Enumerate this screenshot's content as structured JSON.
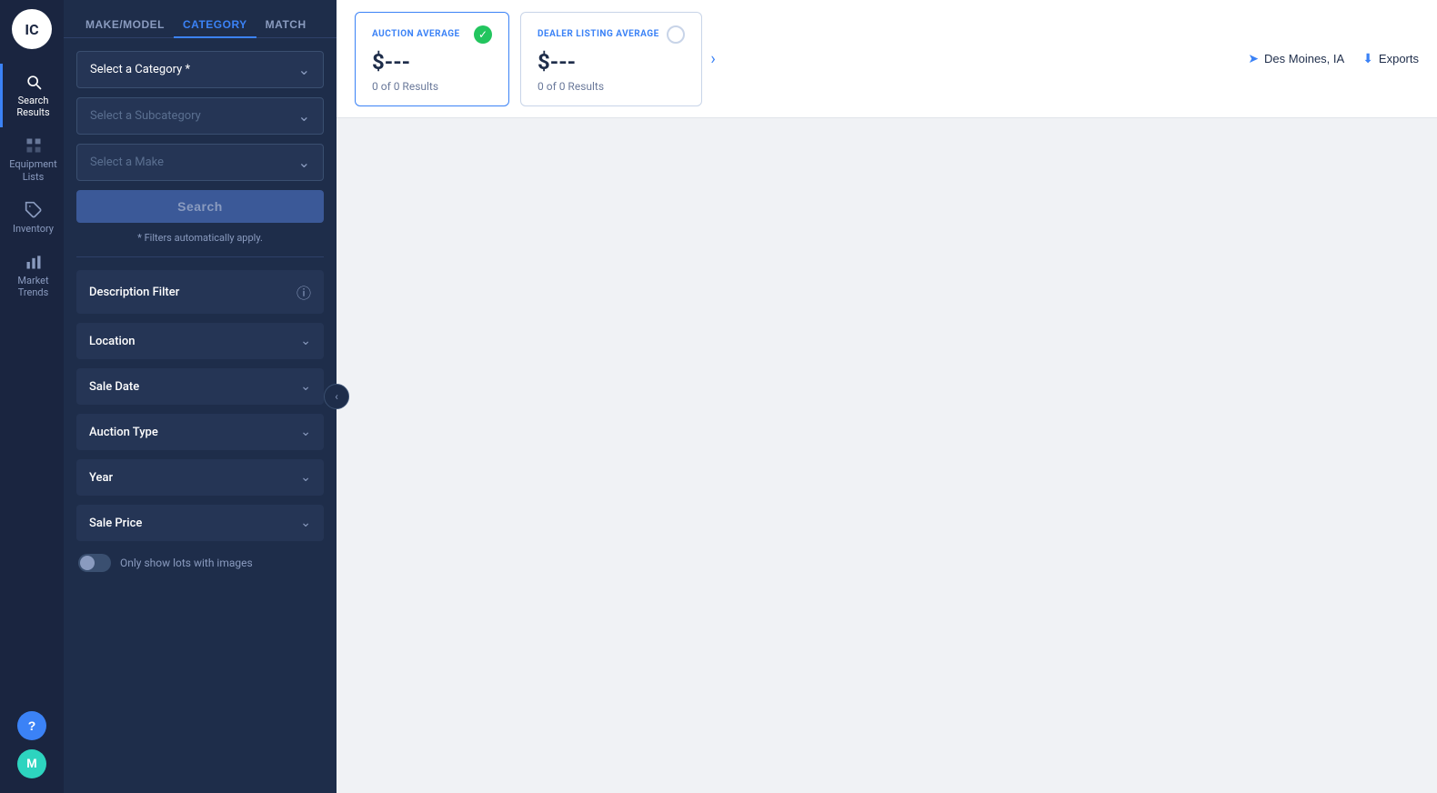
{
  "logo": {
    "text": "IC"
  },
  "nav": {
    "items": [
      {
        "id": "search-results",
        "label": "Search\nResults",
        "icon": "search",
        "active": true
      },
      {
        "id": "equipment-lists",
        "label": "Equipment\nLists",
        "icon": "list",
        "active": false
      },
      {
        "id": "inventory",
        "label": "Inventory",
        "icon": "tag",
        "active": false
      },
      {
        "id": "market-trends",
        "label": "Market\nTrends",
        "icon": "bar-chart",
        "active": false
      }
    ]
  },
  "tabs": [
    {
      "id": "make-model",
      "label": "MAKE/MODEL",
      "active": false
    },
    {
      "id": "category",
      "label": "CATEGORY",
      "active": true
    },
    {
      "id": "match",
      "label": "MATCH",
      "active": false
    }
  ],
  "selects": {
    "category": {
      "placeholder": "Select a Category *",
      "disabled": false
    },
    "subcategory": {
      "placeholder": "Select a Subcategory",
      "disabled": true
    },
    "make": {
      "placeholder": "Select a Make",
      "disabled": true
    }
  },
  "search_button": {
    "label": "Search"
  },
  "filters_note": {
    "text": "* Filters automatically apply."
  },
  "description_filter": {
    "label": "Description Filter"
  },
  "filters": [
    {
      "id": "location",
      "label": "Location"
    },
    {
      "id": "sale-date",
      "label": "Sale Date"
    },
    {
      "id": "auction-type",
      "label": "Auction Type"
    },
    {
      "id": "year",
      "label": "Year"
    },
    {
      "id": "sale-price",
      "label": "Sale Price"
    }
  ],
  "toggle": {
    "label": "Only show lots with images",
    "value": false
  },
  "cards": {
    "auction": {
      "title": "AUCTION AVERAGE",
      "price": "$---",
      "results": "0 of 0 Results",
      "active": true
    },
    "dealer": {
      "title": "DEALER LISTING AVERAGE",
      "price": "$---",
      "results": "0 of 0 Results",
      "active": false
    }
  },
  "topbar": {
    "location": "Des Moines, IA",
    "exports_label": "Exports"
  },
  "help_btn": {
    "label": "?"
  },
  "user_avatar": {
    "label": "M"
  },
  "collapse_icon": "‹"
}
